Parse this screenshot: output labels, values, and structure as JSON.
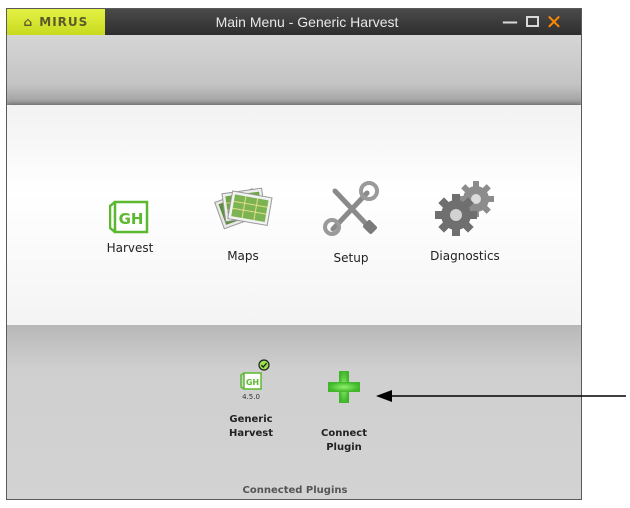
{
  "window": {
    "brand": "MIRUS",
    "title": "Main Menu - Generic Harvest",
    "controls": {
      "minimize_icon": "minimize-icon",
      "maximize_icon": "maximize-icon",
      "close_icon": "close-icon"
    }
  },
  "menu": {
    "items": [
      {
        "label": "Harvest",
        "icon": "generic-harvest-logo-icon"
      },
      {
        "label": "Maps",
        "icon": "maps-icon"
      },
      {
        "label": "Setup",
        "icon": "wrench-screwdriver-icon"
      },
      {
        "label": "Diagnostics",
        "icon": "gears-icon"
      }
    ]
  },
  "plugins": {
    "items": [
      {
        "logo_text": "GH",
        "version": "4.5.0",
        "name_line1": "Generic",
        "name_line2": "Harvest",
        "status": "connected"
      },
      {
        "name_line1": "Connect",
        "name_line2": "Plugin",
        "icon": "plus-icon"
      }
    ],
    "section_label": "Connected Plugins"
  },
  "logos": {
    "harvest": "GH"
  },
  "colors": {
    "brand_yellow": "#d6e62c",
    "accent_green": "#5cb82e",
    "close_orange": "#ff8a00",
    "arrow": "#000000"
  }
}
